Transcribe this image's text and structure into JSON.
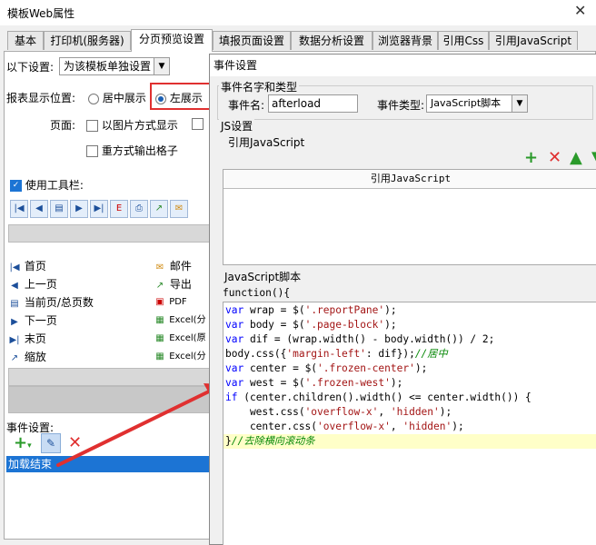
{
  "window": {
    "title": "模板Web属性",
    "close": "✕"
  },
  "tabs": [
    "基本",
    "打印机(服务器)",
    "分页预览设置",
    "填报页面设置",
    "数据分析设置",
    "浏览器背景",
    "引用Css",
    "引用JavaScript"
  ],
  "settings": {
    "label": "以下设置:",
    "mode_value": "为该模板单独设置",
    "position_label": "报表显示位置:",
    "opt_center": "居中展示",
    "opt_left": "左展示",
    "page_label": "页面:",
    "opt_image": "以图片方式显示",
    "opt_repeat": "重方式输出格子",
    "toolbar_label": "使用工具栏:",
    "events_label": "事件设置:",
    "event_item": "加载结束"
  },
  "nav_items": [
    "首页",
    "上一页",
    "当前页/总页数",
    "下一页",
    "末页",
    "缩放"
  ],
  "export_items": [
    "邮件",
    "导出",
    "PDF",
    "Excel(分",
    "Excel(原",
    "Excel(分"
  ],
  "dialog": {
    "title": "事件设置",
    "name_group": "事件名字和类型",
    "event_name_label": "事件名:",
    "event_name_value": "afterload",
    "event_type_label": "事件类型:",
    "event_type_value": "JavaScript脚本",
    "js_group": "JS设置",
    "ref_js_label": "引用JavaScript",
    "ref_js_header": "引用JavaScript",
    "script_label": "JavaScript脚本",
    "script_header": "function(){"
  },
  "code_lines": [
    [
      [
        "kw",
        "var"
      ],
      [
        "t",
        " wrap = $("
      ],
      [
        "str",
        "'.reportPane'"
      ],
      [
        "t",
        ");"
      ]
    ],
    [
      [
        "kw",
        "var"
      ],
      [
        "t",
        " body = $("
      ],
      [
        "str",
        "'.page-block'"
      ],
      [
        "t",
        ");"
      ]
    ],
    [
      [
        "kw",
        "var"
      ],
      [
        "t",
        " dif = (wrap.width() - body.width()) / 2;"
      ]
    ],
    [
      [
        "t",
        "body.css({"
      ],
      [
        "str",
        "'margin-left'"
      ],
      [
        "t",
        ": dif});"
      ],
      [
        "cmt",
        "//居中"
      ]
    ],
    [
      [
        "kw",
        "var"
      ],
      [
        "t",
        " center = $("
      ],
      [
        "str",
        "'.frozen-center'"
      ],
      [
        "t",
        ");"
      ]
    ],
    [
      [
        "kw",
        "var"
      ],
      [
        "t",
        " west = $("
      ],
      [
        "str",
        "'.frozen-west'"
      ],
      [
        "t",
        ");"
      ]
    ],
    [
      [
        "kw",
        "if"
      ],
      [
        "t",
        " (center.children().width() <= center.width()) {"
      ]
    ],
    [
      [
        "t",
        "    west.css("
      ],
      [
        "str",
        "'overflow-x'"
      ],
      [
        "t",
        ", "
      ],
      [
        "str",
        "'hidden'"
      ],
      [
        "t",
        ");"
      ]
    ],
    [
      [
        "t",
        "    center.css("
      ],
      [
        "str",
        "'overflow-x'"
      ],
      [
        "t",
        ", "
      ],
      [
        "str",
        "'hidden'"
      ],
      [
        "t",
        ");"
      ]
    ],
    [
      [
        "t",
        "}"
      ],
      [
        "cmt",
        "//去除横向滚动条"
      ]
    ]
  ],
  "colors": {
    "accent": "#1c74d4",
    "highlight_box": "#e03030",
    "selected_row": "#1c74d4",
    "code_highlight": "#ffffc8"
  }
}
